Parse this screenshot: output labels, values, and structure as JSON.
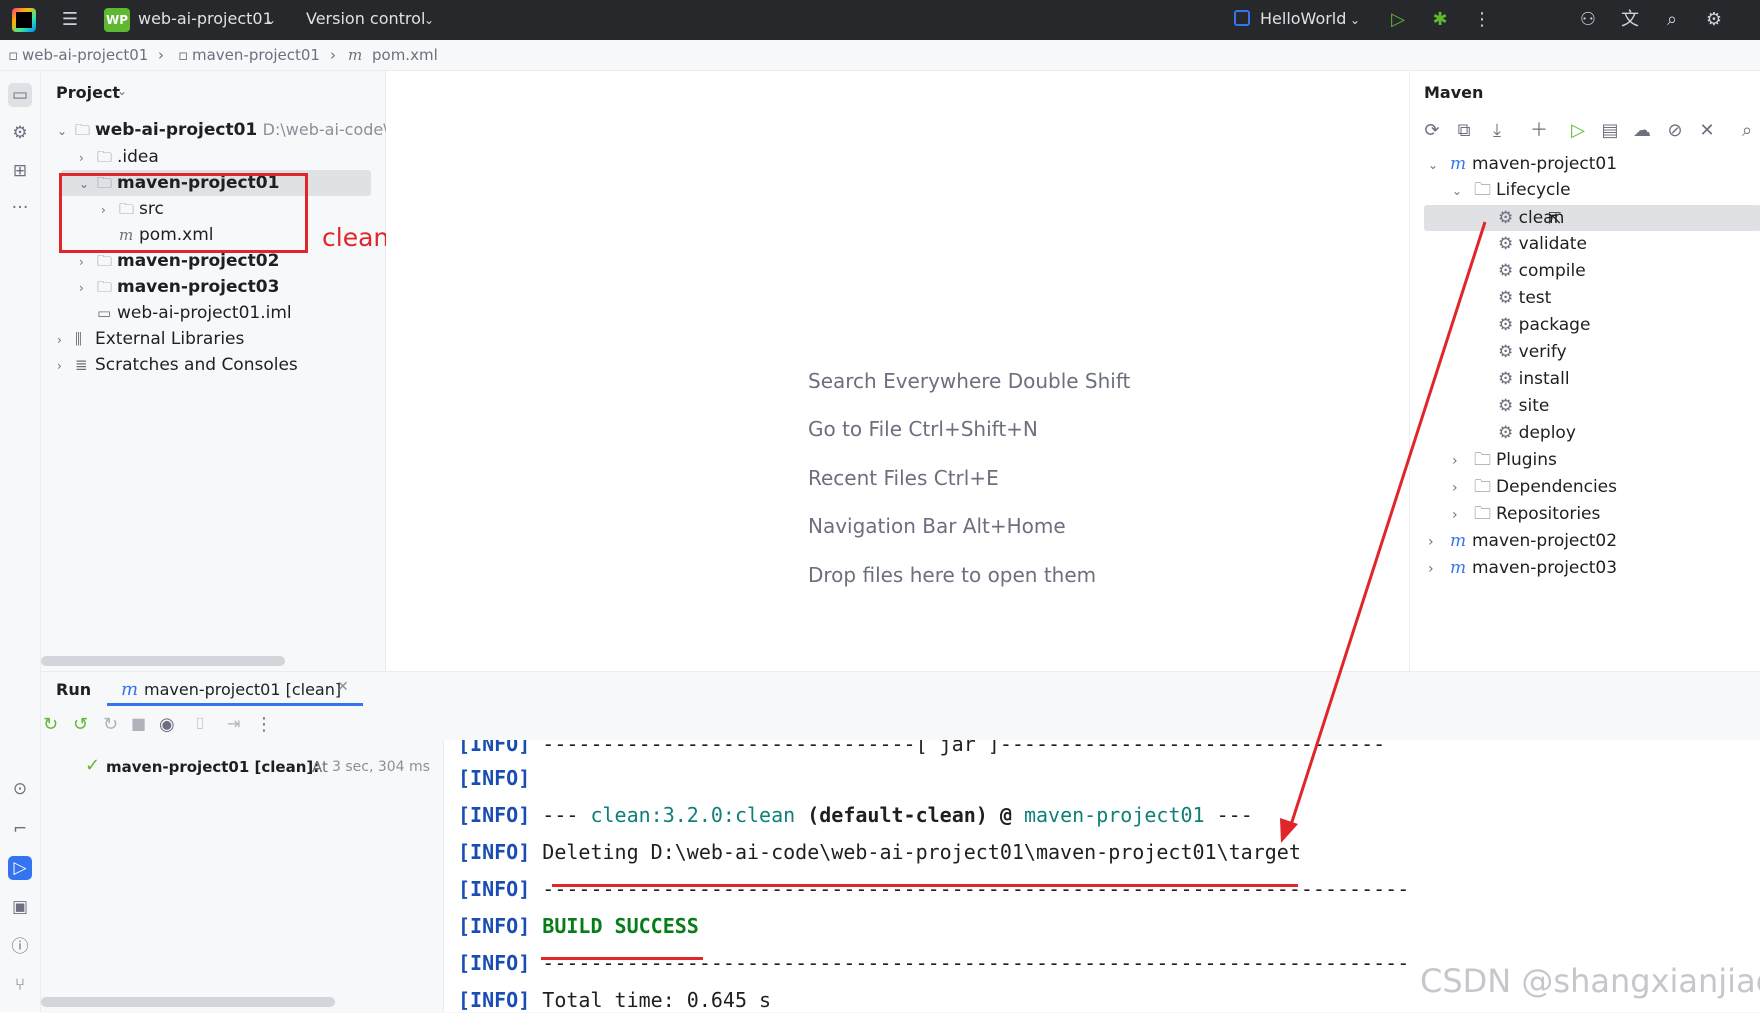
{
  "topbar": {
    "project_badge": "WP",
    "project_name": "web-ai-project01",
    "vcs": "Version control",
    "run_config": "HelloWorld"
  },
  "breadcrumb": [
    "web-ai-project01",
    "maven-project01",
    "pom.xml"
  ],
  "project_panel": {
    "title": "Project",
    "tree": {
      "root": "web-ai-project01",
      "root_path": "D:\\web-ai-code\\w",
      "idea": ".idea",
      "mp1": "maven-project01",
      "src": "src",
      "pom": "pom.xml",
      "mp2": "maven-project02",
      "mp3": "maven-project03",
      "iml": "web-ai-project01.iml",
      "ext": "External Libraries",
      "scratches": "Scratches and Consoles"
    }
  },
  "annotation": {
    "text": "clean  target没有了"
  },
  "editor_hints": [
    "Search Everywhere Double Shift",
    "Go to File Ctrl+Shift+N",
    "Recent Files Ctrl+E",
    "Navigation Bar Alt+Home",
    "Drop files here to open them"
  ],
  "maven": {
    "title": "Maven",
    "project1": "maven-project01",
    "lifecycle": "Lifecycle",
    "goals": [
      "clean",
      "validate",
      "compile",
      "test",
      "package",
      "verify",
      "install",
      "site",
      "deploy"
    ],
    "plugins": "Plugins",
    "dependencies": "Dependencies",
    "repositories": "Repositories",
    "project2": "maven-project02",
    "project3": "maven-project03"
  },
  "run_panel": {
    "tab_run": "Run",
    "tab_config": "maven-project01 [clean]",
    "result_title": "maven-project01 [clean]:",
    "result_status": "At",
    "result_time": "3 sec, 304 ms"
  },
  "console": {
    "l0_tag": "[INFO]",
    "l0_text": " -------------------------------[ jar ]--------------------------------",
    "l1_tag": "[INFO]",
    "l2_tag": "[INFO]",
    "l2_a": " --- ",
    "l2_b": "clean:3.2.0:clean",
    "l2_c": " (default-clean) @ ",
    "l2_d": "maven-project01",
    "l2_e": " ---",
    "l3_tag": "[INFO]",
    "l3_text": " Deleting D:\\web-ai-code\\web-ai-project01\\maven-project01\\target",
    "l4_tag": "[INFO]",
    "l4_text": " ------------------------------------------------------------------------",
    "l5_tag": "[INFO]",
    "l5_text": "BUILD SUCCESS",
    "l6_tag": "[INFO]",
    "l6_text": " ------------------------------------------------------------------------",
    "l7_tag": "[INFO]",
    "l7_text": " Total time:  0.645 s"
  },
  "watermark": "CSDN @shangxianjiao",
  "colors": {
    "annotation_red": "#e0262b",
    "accent": "#3574f0",
    "topbar": "#27282c"
  }
}
